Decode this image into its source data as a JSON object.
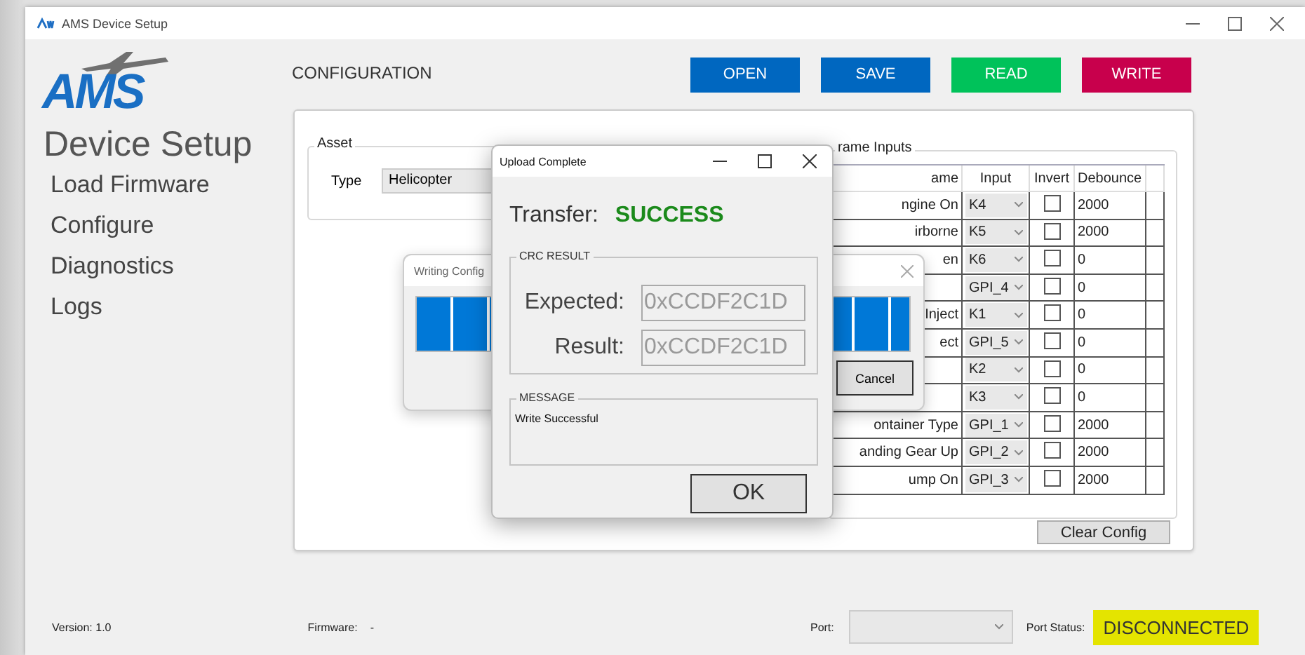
{
  "window": {
    "title": "AMS Device Setup"
  },
  "sidebar": {
    "logo": "AMS",
    "subtitle": "Device Setup",
    "items": [
      {
        "label": "Load Firmware"
      },
      {
        "label": "Configure"
      },
      {
        "label": "Diagnostics"
      },
      {
        "label": "Logs"
      }
    ]
  },
  "header": {
    "title": "CONFIGURATION",
    "buttons": [
      {
        "label": "OPEN",
        "color": "#0067c0"
      },
      {
        "label": "SAVE",
        "color": "#0067c0"
      },
      {
        "label": "READ",
        "color": "#00c25a"
      },
      {
        "label": "WRITE",
        "color": "#c8004c"
      }
    ]
  },
  "asset": {
    "legend": "Asset",
    "type_label": "Type",
    "type_value": "Helicopter"
  },
  "frame_inputs": {
    "legend": "rame Inputs",
    "columns": [
      "ame",
      "Input",
      "Invert",
      "Debounce"
    ],
    "rows": [
      {
        "name": "ngine On",
        "input": "K4",
        "invert": false,
        "debounce": "2000"
      },
      {
        "name": "irborne",
        "input": "K5",
        "invert": false,
        "debounce": "2000"
      },
      {
        "name": "en",
        "input": "K6",
        "invert": false,
        "debounce": "0"
      },
      {
        "input": "GPI_4",
        "invert": false,
        "debounce": "0"
      },
      {
        "name": "Inject",
        "input": "K1",
        "invert": false,
        "debounce": "0"
      },
      {
        "name": "ect",
        "input": "GPI_5",
        "invert": false,
        "debounce": "0"
      },
      {
        "input": "K2",
        "invert": false,
        "debounce": "0"
      },
      {
        "input": "K3",
        "invert": false,
        "debounce": "0"
      },
      {
        "name": "ontainer Type",
        "input": "GPI_1",
        "invert": false,
        "debounce": "2000"
      },
      {
        "name": "anding Gear Up",
        "input": "GPI_2",
        "invert": false,
        "debounce": "2000"
      },
      {
        "name": "ump On",
        "input": "GPI_3",
        "invert": false,
        "debounce": "2000"
      }
    ]
  },
  "clear_button": "Clear Config",
  "progress_dialog": {
    "title": "Writing Config",
    "level": 1,
    "cancel": "Cancel"
  },
  "upload_dialog": {
    "title": "Upload Complete",
    "transfer_label": "Transfer:",
    "transfer_status": "SUCCESS",
    "crc_legend": "CRC RESULT",
    "expected_label": "Expected:",
    "expected_value": "0xCCDF2C1D",
    "result_label": "Result:",
    "result_value": "0xCCDF2C1D",
    "message_legend": "MESSAGE",
    "message": "Write Successful",
    "ok": "OK"
  },
  "status_bar": {
    "version": "Version: 1.0",
    "firmware_label": "Firmware:",
    "firmware_value": "-",
    "port_label": "Port:",
    "port_status_label": "Port Status:",
    "port_status": "DISCONNECTED"
  }
}
